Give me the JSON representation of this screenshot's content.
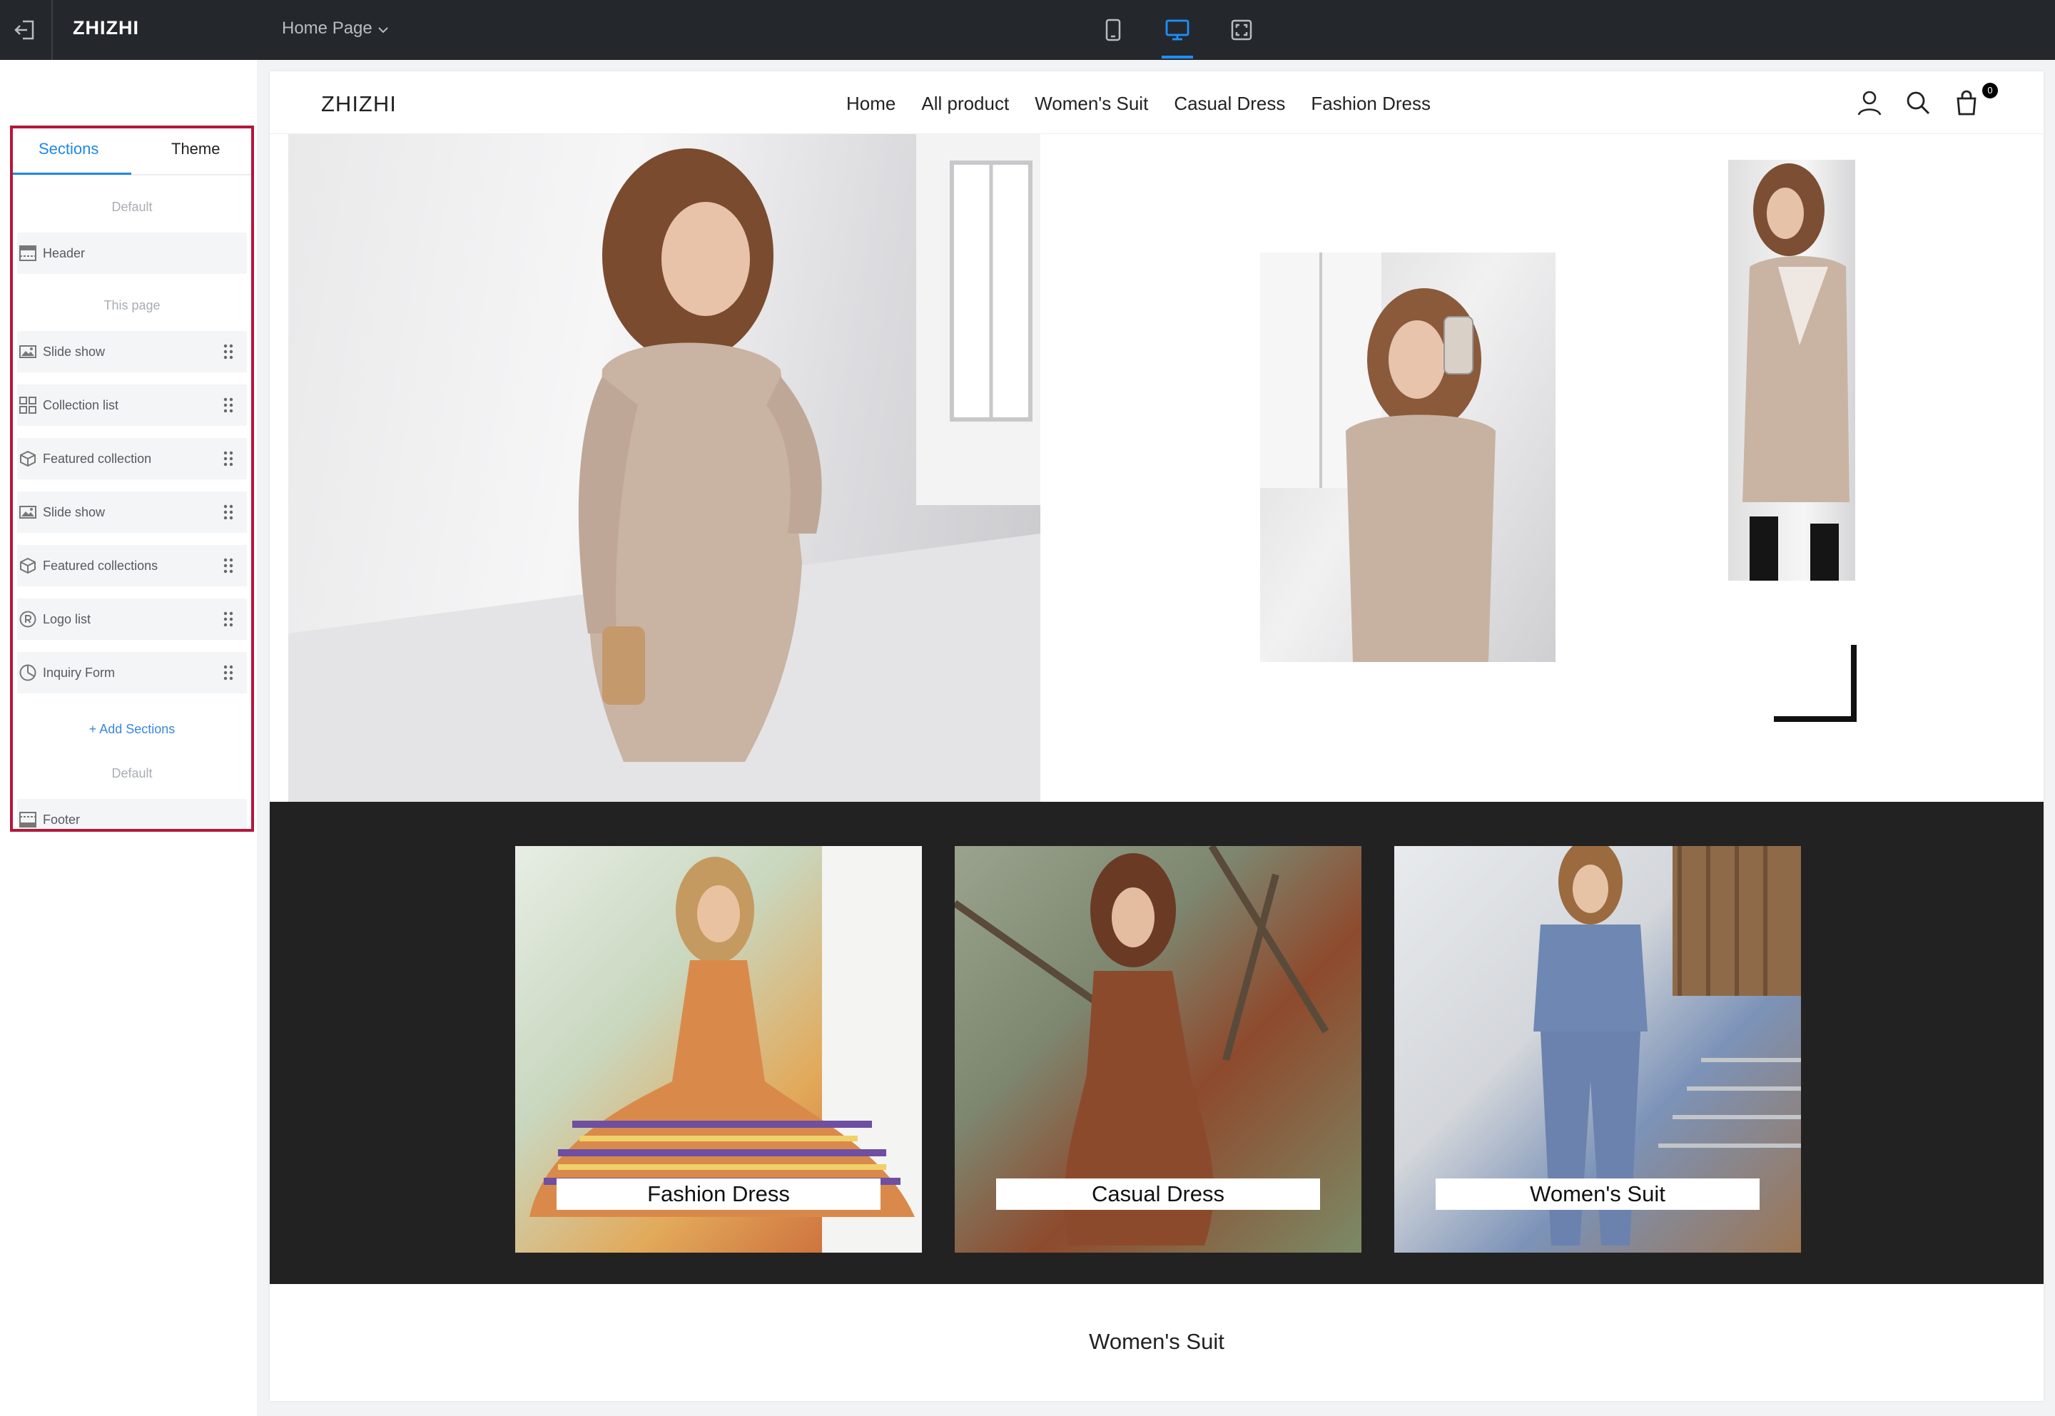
{
  "topbar": {
    "brand": "ZHIZHI",
    "page_selector": "Home Page",
    "devices": [
      "mobile-icon",
      "desktop-icon",
      "fullscreen-icon"
    ],
    "active_device": "desktop",
    "accent": "#1e90ff"
  },
  "left_panel": {
    "tabs": [
      {
        "label": "Sections",
        "active": true
      },
      {
        "label": "Theme",
        "active": false
      }
    ],
    "groups": {
      "default_top": "Default",
      "this_page": "This page",
      "default_bottom": "Default"
    },
    "header_row": {
      "label": "Header",
      "icon": "header-layout-icon"
    },
    "items": [
      {
        "label": "Slide show",
        "icon": "image-gallery-icon"
      },
      {
        "label": "Collection list",
        "icon": "grid-icon"
      },
      {
        "label": "Featured collection",
        "icon": "cube-icon"
      },
      {
        "label": "Slide show",
        "icon": "image-gallery-icon"
      },
      {
        "label": "Featured collections",
        "icon": "cube-icon"
      },
      {
        "label": "Logo list",
        "icon": "registered-icon"
      },
      {
        "label": "Inquiry Form",
        "icon": "pie-chart-icon"
      }
    ],
    "add_sections": "+ Add Sections",
    "footer_row": {
      "label": "Footer",
      "icon": "footer-layout-icon"
    },
    "highlight_color": "#b3173a"
  },
  "site": {
    "logo": "ZHIZHI",
    "nav": [
      "Home",
      "All product",
      "Women's Suit",
      "Casual Dress",
      "Fashion Dress"
    ],
    "cart_count": "0",
    "collection_cards": [
      {
        "caption": "Fashion Dress"
      },
      {
        "caption": "Casual Dress"
      },
      {
        "caption": "Women's Suit"
      }
    ],
    "featured_title": "Women's Suit"
  }
}
